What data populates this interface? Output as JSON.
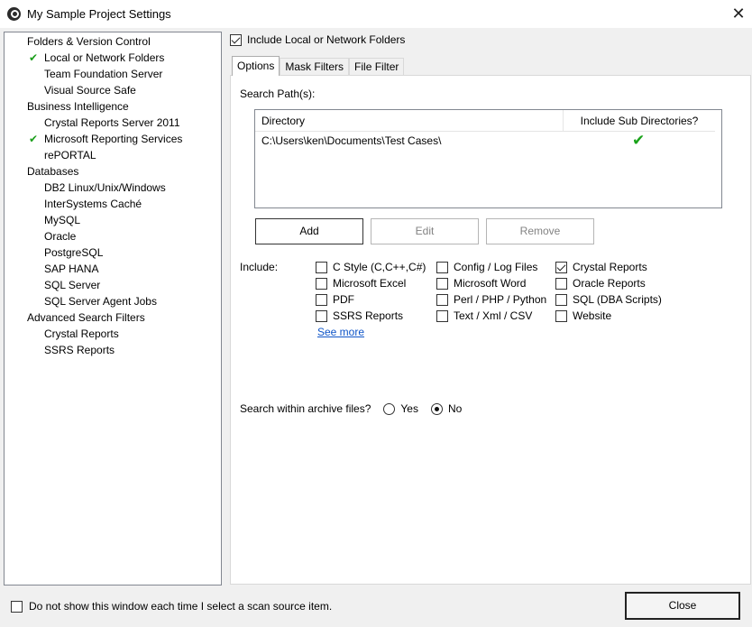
{
  "window": {
    "title": "My Sample Project Settings",
    "close_glyph": "✕"
  },
  "tree": {
    "items": [
      {
        "label": "Folders & Version Control",
        "level": "cat",
        "checked": false
      },
      {
        "label": "Local or Network Folders",
        "level": "sub",
        "checked": true,
        "selected": true
      },
      {
        "label": "Team Foundation Server",
        "level": "sub",
        "checked": false
      },
      {
        "label": "Visual Source Safe",
        "level": "sub",
        "checked": false
      },
      {
        "label": "Business Intelligence",
        "level": "cat",
        "checked": false
      },
      {
        "label": "Crystal Reports Server 2011",
        "level": "sub",
        "checked": false
      },
      {
        "label": "Microsoft Reporting Services",
        "level": "sub",
        "checked": true
      },
      {
        "label": "rePORTAL",
        "level": "sub",
        "checked": false
      },
      {
        "label": "Databases",
        "level": "cat",
        "checked": false
      },
      {
        "label": "DB2 Linux/Unix/Windows",
        "level": "sub",
        "checked": false
      },
      {
        "label": "InterSystems Caché",
        "level": "sub",
        "checked": false
      },
      {
        "label": "MySQL",
        "level": "sub",
        "checked": false
      },
      {
        "label": "Oracle",
        "level": "sub",
        "checked": false
      },
      {
        "label": "PostgreSQL",
        "level": "sub",
        "checked": false
      },
      {
        "label": "SAP HANA",
        "level": "sub",
        "checked": false
      },
      {
        "label": "SQL Server",
        "level": "sub",
        "checked": false
      },
      {
        "label": "SQL Server Agent Jobs",
        "level": "sub",
        "checked": false
      },
      {
        "label": "Advanced Search Filters",
        "level": "cat",
        "checked": false
      },
      {
        "label": "Crystal Reports",
        "level": "sub",
        "checked": false
      },
      {
        "label": "SSRS Reports",
        "level": "sub",
        "checked": false
      }
    ],
    "check_glyph": "✔"
  },
  "main": {
    "include_folders_label": "Include Local or Network Folders",
    "include_folders_checked": true,
    "tabs": [
      {
        "label": "Options",
        "active": true
      },
      {
        "label": "Mask Filters",
        "active": false
      },
      {
        "label": "File Filter",
        "active": false
      }
    ],
    "search_paths_label": "Search Path(s):",
    "grid": {
      "col_directory": "Directory",
      "col_subdirs": "Include Sub Directories?",
      "rows": [
        {
          "directory": "C:\\Users\\ken\\Documents\\Test Cases\\",
          "subdirs_glyph": "✔"
        }
      ]
    },
    "buttons": {
      "add": "Add",
      "edit": "Edit",
      "remove": "Remove"
    },
    "include_label": "Include:",
    "include_options": [
      {
        "label": "C Style (C,C++,C#)",
        "checked": false
      },
      {
        "label": "Microsoft Excel",
        "checked": false
      },
      {
        "label": "PDF",
        "checked": false
      },
      {
        "label": "SSRS Reports",
        "checked": false
      },
      {
        "label": "Config / Log Files",
        "checked": false
      },
      {
        "label": "Microsoft Word",
        "checked": false
      },
      {
        "label": "Perl / PHP / Python",
        "checked": false
      },
      {
        "label": "Text / Xml / CSV",
        "checked": false
      },
      {
        "label": "Crystal Reports",
        "checked": true
      },
      {
        "label": "Oracle Reports",
        "checked": false
      },
      {
        "label": "SQL (DBA Scripts)",
        "checked": false
      },
      {
        "label": "Website",
        "checked": false
      }
    ],
    "see_more": "See more",
    "archive_label": "Search within archive files?",
    "archive_yes": "Yes",
    "archive_no": "No",
    "archive_value": "No"
  },
  "footer": {
    "dont_show_label": "Do not show this window each time I select a scan source item.",
    "dont_show_checked": false,
    "close_label": "Close"
  }
}
